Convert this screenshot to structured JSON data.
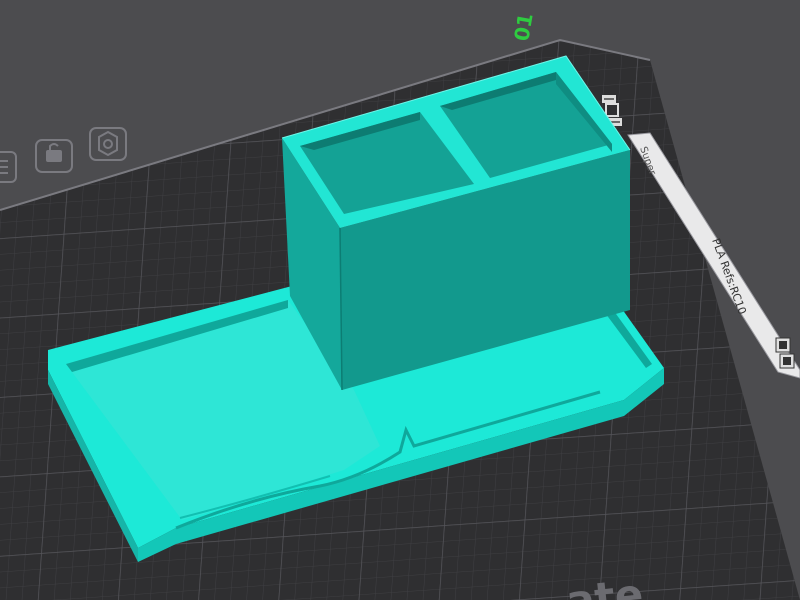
{
  "viewport": {
    "background_color": "#4c4c4f",
    "bed_color": "#2f2f31",
    "grid_color": "#47474a",
    "model_color": "#1fd4c4"
  },
  "bed": {
    "corner_number": "01",
    "side_label_top": "Super",
    "side_label_main": "PLA Refs:RC10",
    "bottom_text": "ate",
    "bed_icons": [
      "list-icon",
      "layers-icon",
      "gear-icon"
    ],
    "side_icons": [
      "arrow-icon",
      "square-icon",
      "arrow-icon"
    ]
  },
  "model": {
    "name": "pen-holder-with-tray"
  }
}
